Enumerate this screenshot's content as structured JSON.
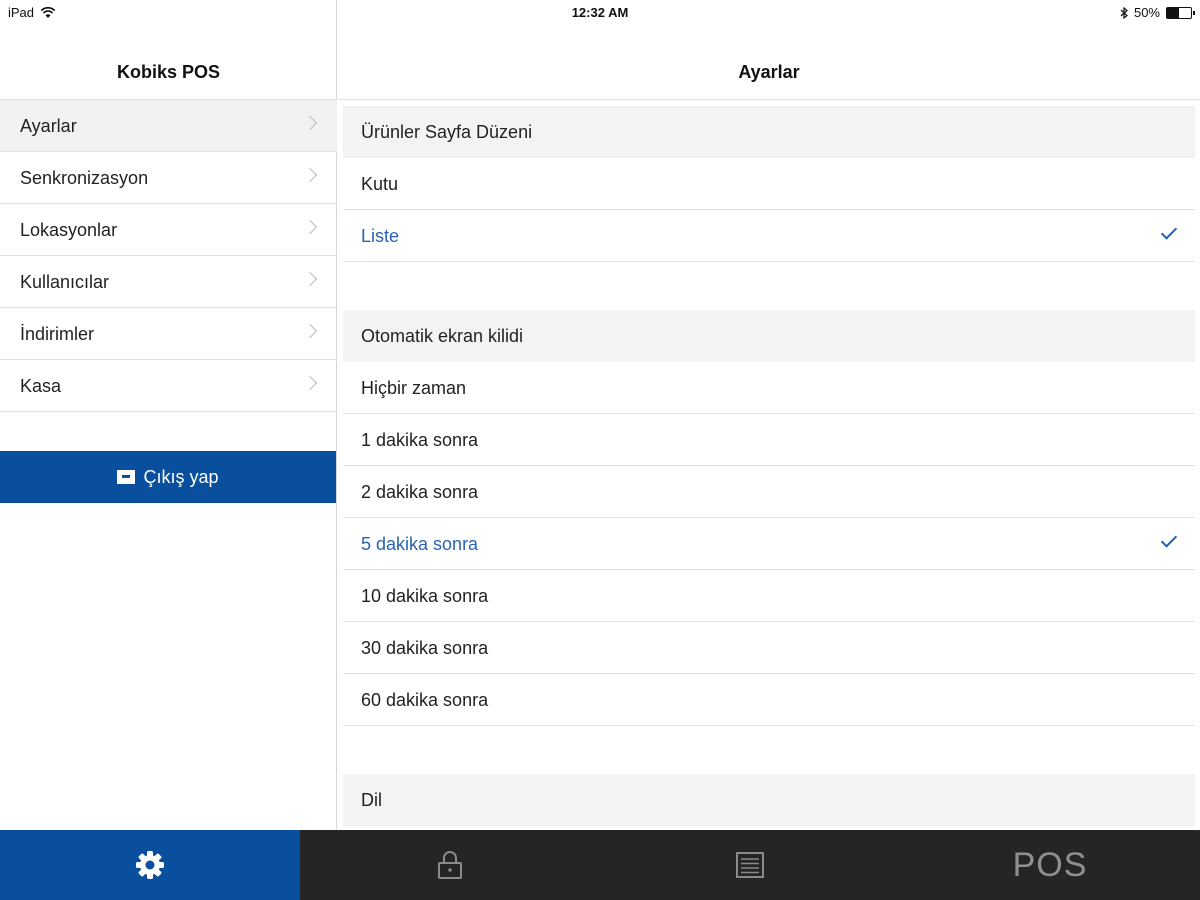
{
  "status_bar": {
    "device": "iPad",
    "time": "12:32 AM",
    "battery": "50%"
  },
  "left_panel": {
    "title": "Kobiks POS",
    "menu": [
      {
        "label": "Ayarlar",
        "active": true
      },
      {
        "label": "Senkronizasyon",
        "active": false
      },
      {
        "label": "Lokasyonlar",
        "active": false
      },
      {
        "label": "Kullanıcılar",
        "active": false
      },
      {
        "label": "İndirimler",
        "active": false
      },
      {
        "label": "Kasa",
        "active": false
      }
    ],
    "logout_label": "Çıkış yap"
  },
  "right_panel": {
    "title": "Ayarlar",
    "sections": [
      {
        "header": "Ürünler Sayfa Düzeni",
        "options": [
          {
            "label": "Kutu",
            "selected": false
          },
          {
            "label": "Liste",
            "selected": true
          }
        ]
      },
      {
        "header": "Otomatik ekran kilidi",
        "options": [
          {
            "label": "Hiçbir zaman",
            "selected": false
          },
          {
            "label": "1 dakika sonra",
            "selected": false
          },
          {
            "label": "2 dakika sonra",
            "selected": false
          },
          {
            "label": "5 dakika sonra",
            "selected": true
          },
          {
            "label": "10 dakika sonra",
            "selected": false
          },
          {
            "label": "30 dakika sonra",
            "selected": false
          },
          {
            "label": "60 dakika sonra",
            "selected": false
          }
        ]
      },
      {
        "header": "Dil",
        "options": []
      }
    ]
  },
  "tab_bar": {
    "tabs": [
      {
        "icon": "gear-icon",
        "active": true
      },
      {
        "icon": "lock-icon",
        "active": false
      },
      {
        "icon": "list-icon",
        "active": false
      },
      {
        "label": "POS",
        "active": false
      }
    ]
  },
  "colors": {
    "accent": "#0a4f9e",
    "selected_text": "#2a62b6",
    "tabbar_bg": "#252525"
  }
}
